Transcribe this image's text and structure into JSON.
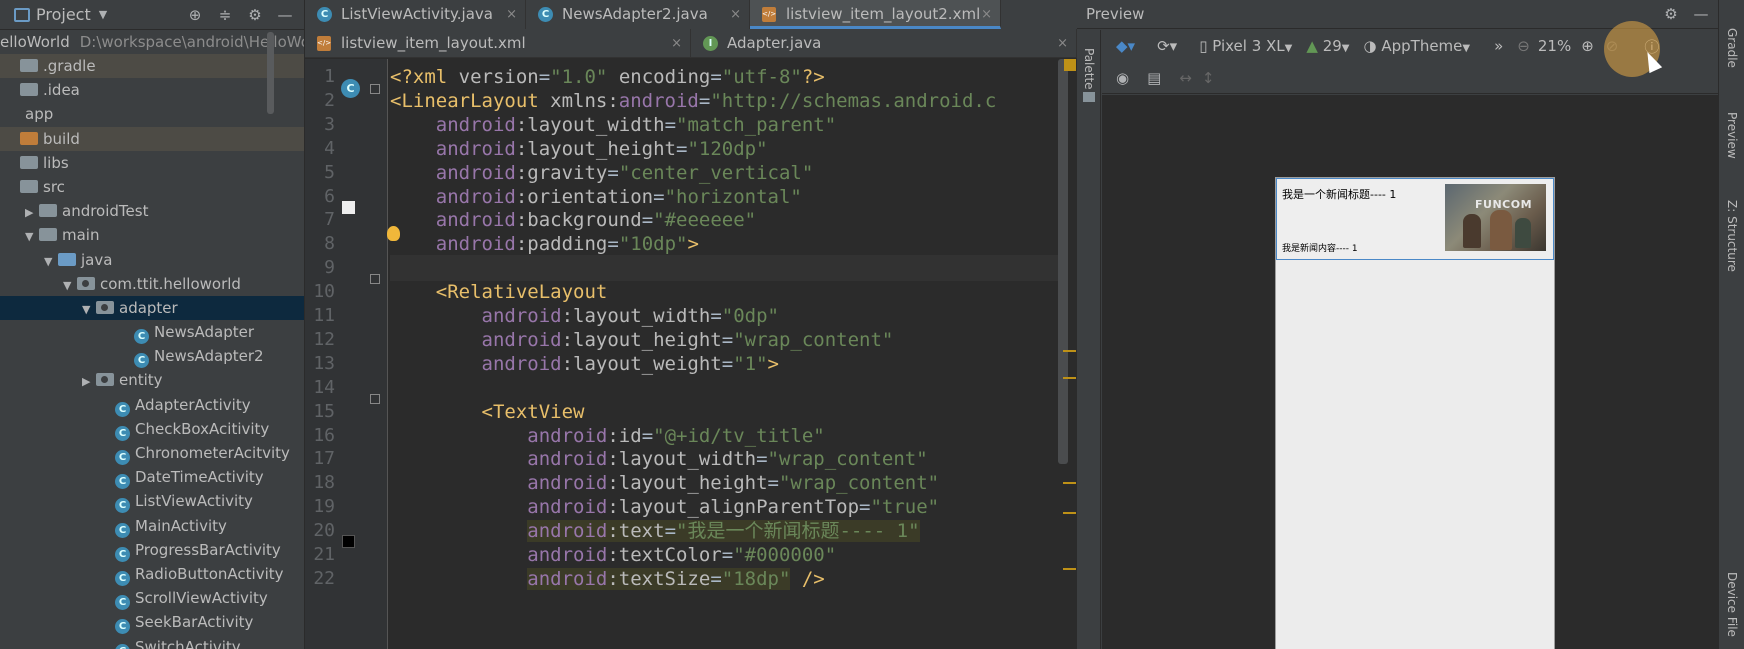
{
  "project_panel": {
    "title": "Project",
    "root_name": "elloWorld",
    "root_path": "D:\\workspace\\android\\HelloWor",
    "tree": [
      {
        "label": ".gradle",
        "type": "folder",
        "depth": 0,
        "arrow": "",
        "state": "hl"
      },
      {
        "label": ".idea",
        "type": "folder",
        "depth": 0,
        "arrow": "",
        "state": ""
      },
      {
        "label": "app",
        "type": "none",
        "depth": 0,
        "arrow": "",
        "state": ""
      },
      {
        "label": "build",
        "type": "folder-orange",
        "depth": 0,
        "arrow": "",
        "state": "hl"
      },
      {
        "label": "libs",
        "type": "folder",
        "depth": 0,
        "arrow": "",
        "state": ""
      },
      {
        "label": "src",
        "type": "folder",
        "depth": 0,
        "arrow": "",
        "state": ""
      },
      {
        "label": "androidTest",
        "type": "folder",
        "depth": 1,
        "arrow": "▶",
        "state": ""
      },
      {
        "label": "main",
        "type": "folder",
        "depth": 1,
        "arrow": "▼",
        "state": ""
      },
      {
        "label": "java",
        "type": "folder-blue",
        "depth": 2,
        "arrow": "▼",
        "state": ""
      },
      {
        "label": "com.ttit.helloworld",
        "type": "package",
        "depth": 3,
        "arrow": "▼",
        "state": ""
      },
      {
        "label": "adapter",
        "type": "package",
        "depth": 4,
        "arrow": "▼",
        "state": "sel"
      },
      {
        "label": "NewsAdapter",
        "type": "class",
        "depth": 6,
        "arrow": "",
        "state": ""
      },
      {
        "label": "NewsAdapter2",
        "type": "class",
        "depth": 6,
        "arrow": "",
        "state": ""
      },
      {
        "label": "entity",
        "type": "package",
        "depth": 4,
        "arrow": "▶",
        "state": ""
      },
      {
        "label": "AdapterActivity",
        "type": "class",
        "depth": 5,
        "arrow": "",
        "state": ""
      },
      {
        "label": "CheckBoxAcitivity",
        "type": "class",
        "depth": 5,
        "arrow": "",
        "state": ""
      },
      {
        "label": "ChronometerAcitvity",
        "type": "class",
        "depth": 5,
        "arrow": "",
        "state": ""
      },
      {
        "label": "DateTimeActivity",
        "type": "class",
        "depth": 5,
        "arrow": "",
        "state": ""
      },
      {
        "label": "ListViewActivity",
        "type": "class",
        "depth": 5,
        "arrow": "",
        "state": ""
      },
      {
        "label": "MainActivity",
        "type": "class",
        "depth": 5,
        "arrow": "",
        "state": ""
      },
      {
        "label": "ProgressBarActivity",
        "type": "class",
        "depth": 5,
        "arrow": "",
        "state": ""
      },
      {
        "label": "RadioButtonActivity",
        "type": "class",
        "depth": 5,
        "arrow": "",
        "state": ""
      },
      {
        "label": "ScrollViewActivity",
        "type": "class",
        "depth": 5,
        "arrow": "",
        "state": ""
      },
      {
        "label": "SeekBarActivity",
        "type": "class",
        "depth": 5,
        "arrow": "",
        "state": ""
      },
      {
        "label": "SwitchActivity",
        "type": "class",
        "depth": 5,
        "arrow": "",
        "state": ""
      }
    ]
  },
  "editor": {
    "tabs_row1": [
      {
        "label": "ListViewActivity.java",
        "icon": "class",
        "active": false
      },
      {
        "label": "NewsAdapter2.java",
        "icon": "class",
        "active": false
      },
      {
        "label": "listview_item_layout2.xml",
        "icon": "xml",
        "active": true
      }
    ],
    "tabs_row2": [
      {
        "label": "listview_item_layout.xml",
        "icon": "xml",
        "active": false
      },
      {
        "label": "Adapter.java",
        "icon": "interface",
        "active": false
      }
    ],
    "close_glyph": "×",
    "line_numbers": [
      "1",
      "2",
      "3",
      "4",
      "5",
      "6",
      "7",
      "8",
      "9",
      "10",
      "11",
      "12",
      "13",
      "14",
      "15",
      "16",
      "17",
      "18",
      "19",
      "20",
      "21",
      "22"
    ],
    "lines": [
      [
        {
          "t": "<?xml ",
          "c": "pi"
        },
        {
          "t": "version",
          "c": "attr"
        },
        {
          "t": "=",
          "c": "plain"
        },
        {
          "t": "\"1.0\"",
          "c": "val"
        },
        {
          "t": " encoding",
          "c": "attr"
        },
        {
          "t": "=",
          "c": "plain"
        },
        {
          "t": "\"utf-8\"",
          "c": "val"
        },
        {
          "t": "?>",
          "c": "pi"
        }
      ],
      [
        {
          "t": "<LinearLayout ",
          "c": "tag"
        },
        {
          "t": "xmlns:",
          "c": "attr"
        },
        {
          "t": "android",
          "c": "ns"
        },
        {
          "t": "=",
          "c": "plain"
        },
        {
          "t": "\"http://schemas.android.c",
          "c": "val"
        }
      ],
      [
        {
          "t": "    ",
          "c": "plain"
        },
        {
          "t": "android",
          "c": "ns"
        },
        {
          "t": ":layout_width",
          "c": "attr"
        },
        {
          "t": "=",
          "c": "plain"
        },
        {
          "t": "\"match_parent\"",
          "c": "val"
        }
      ],
      [
        {
          "t": "    ",
          "c": "plain"
        },
        {
          "t": "android",
          "c": "ns"
        },
        {
          "t": ":layout_height",
          "c": "attr"
        },
        {
          "t": "=",
          "c": "plain"
        },
        {
          "t": "\"120dp\"",
          "c": "val"
        }
      ],
      [
        {
          "t": "    ",
          "c": "plain"
        },
        {
          "t": "android",
          "c": "ns"
        },
        {
          "t": ":gravity",
          "c": "attr"
        },
        {
          "t": "=",
          "c": "plain"
        },
        {
          "t": "\"center_vertical\"",
          "c": "val"
        }
      ],
      [
        {
          "t": "    ",
          "c": "plain"
        },
        {
          "t": "android",
          "c": "ns"
        },
        {
          "t": ":orientation",
          "c": "attr"
        },
        {
          "t": "=",
          "c": "plain"
        },
        {
          "t": "\"horizontal\"",
          "c": "val"
        }
      ],
      [
        {
          "t": "    ",
          "c": "plain"
        },
        {
          "t": "android",
          "c": "ns"
        },
        {
          "t": ":background",
          "c": "attr"
        },
        {
          "t": "=",
          "c": "plain"
        },
        {
          "t": "\"#eeeeee\"",
          "c": "val"
        }
      ],
      [
        {
          "t": "    ",
          "c": "plain"
        },
        {
          "t": "android",
          "c": "ns"
        },
        {
          "t": ":padding",
          "c": "attr"
        },
        {
          "t": "=",
          "c": "plain"
        },
        {
          "t": "\"10dp\"",
          "c": "val"
        },
        {
          "t": ">",
          "c": "tag"
        }
      ],
      [],
      [
        {
          "t": "    ",
          "c": "plain"
        },
        {
          "t": "<RelativeLayout",
          "c": "tag"
        }
      ],
      [
        {
          "t": "        ",
          "c": "plain"
        },
        {
          "t": "android",
          "c": "ns"
        },
        {
          "t": ":layout_width",
          "c": "attr"
        },
        {
          "t": "=",
          "c": "plain"
        },
        {
          "t": "\"0dp\"",
          "c": "val"
        }
      ],
      [
        {
          "t": "        ",
          "c": "plain"
        },
        {
          "t": "android",
          "c": "ns"
        },
        {
          "t": ":layout_height",
          "c": "attr"
        },
        {
          "t": "=",
          "c": "plain"
        },
        {
          "t": "\"wrap_content\"",
          "c": "val"
        }
      ],
      [
        {
          "t": "        ",
          "c": "plain"
        },
        {
          "t": "android",
          "c": "ns"
        },
        {
          "t": ":layout_weight",
          "c": "attr"
        },
        {
          "t": "=",
          "c": "plain"
        },
        {
          "t": "\"1\"",
          "c": "val"
        },
        {
          "t": ">",
          "c": "tag"
        }
      ],
      [],
      [
        {
          "t": "        ",
          "c": "plain"
        },
        {
          "t": "<TextView",
          "c": "tag"
        }
      ],
      [
        {
          "t": "            ",
          "c": "plain"
        },
        {
          "t": "android",
          "c": "ns"
        },
        {
          "t": ":id",
          "c": "attr"
        },
        {
          "t": "=",
          "c": "plain"
        },
        {
          "t": "\"@+id/tv_title\"",
          "c": "val"
        }
      ],
      [
        {
          "t": "            ",
          "c": "plain"
        },
        {
          "t": "android",
          "c": "ns"
        },
        {
          "t": ":layout_width",
          "c": "attr"
        },
        {
          "t": "=",
          "c": "plain"
        },
        {
          "t": "\"wrap_content\"",
          "c": "val"
        }
      ],
      [
        {
          "t": "            ",
          "c": "plain"
        },
        {
          "t": "android",
          "c": "ns"
        },
        {
          "t": ":layout_height",
          "c": "attr"
        },
        {
          "t": "=",
          "c": "plain"
        },
        {
          "t": "\"wrap_content\"",
          "c": "val"
        }
      ],
      [
        {
          "t": "            ",
          "c": "plain"
        },
        {
          "t": "android",
          "c": "ns"
        },
        {
          "t": ":layout_alignParentTop",
          "c": "attr"
        },
        {
          "t": "=",
          "c": "plain"
        },
        {
          "t": "\"true\"",
          "c": "val"
        }
      ],
      [
        {
          "t": "            ",
          "c": "plain"
        },
        {
          "t": "android",
          "c": "ns",
          "hl": true
        },
        {
          "t": ":text",
          "c": "attr",
          "hl": true
        },
        {
          "t": "=",
          "c": "plain",
          "hl": true
        },
        {
          "t": "\"我是一个新闻标题---- 1\"",
          "c": "val",
          "hl": true
        }
      ],
      [
        {
          "t": "            ",
          "c": "plain"
        },
        {
          "t": "android",
          "c": "ns"
        },
        {
          "t": ":textColor",
          "c": "attr"
        },
        {
          "t": "=",
          "c": "plain"
        },
        {
          "t": "\"#000000\"",
          "c": "val"
        }
      ],
      [
        {
          "t": "            ",
          "c": "plain"
        },
        {
          "t": "android",
          "c": "ns",
          "hl": true
        },
        {
          "t": ":textSize",
          "c": "attr",
          "hl": true
        },
        {
          "t": "=",
          "c": "plain",
          "hl": true
        },
        {
          "t": "\"18dp\"",
          "c": "val",
          "hl": true
        },
        {
          "t": " />",
          "c": "tag"
        }
      ]
    ]
  },
  "preview": {
    "title": "Preview",
    "palette_label": "Palette",
    "device": "Pixel 3 XL",
    "api": "29",
    "theme": "AppTheme",
    "zoom": "21%",
    "overflow": "»",
    "news_title": "我是一个新闻标题---- 1",
    "news_content": "我是新闻内容---- 1",
    "image_logo": "FUNCOM"
  },
  "right_strip": {
    "labels": [
      "Gradle",
      "Preview",
      "Z: Structure",
      "Device File"
    ]
  },
  "colors": {
    "accent": "#4a88c7",
    "selection": "#0d293e",
    "tag": "#e8bf6a",
    "namespace": "#9876aa",
    "value": "#6a8759"
  }
}
